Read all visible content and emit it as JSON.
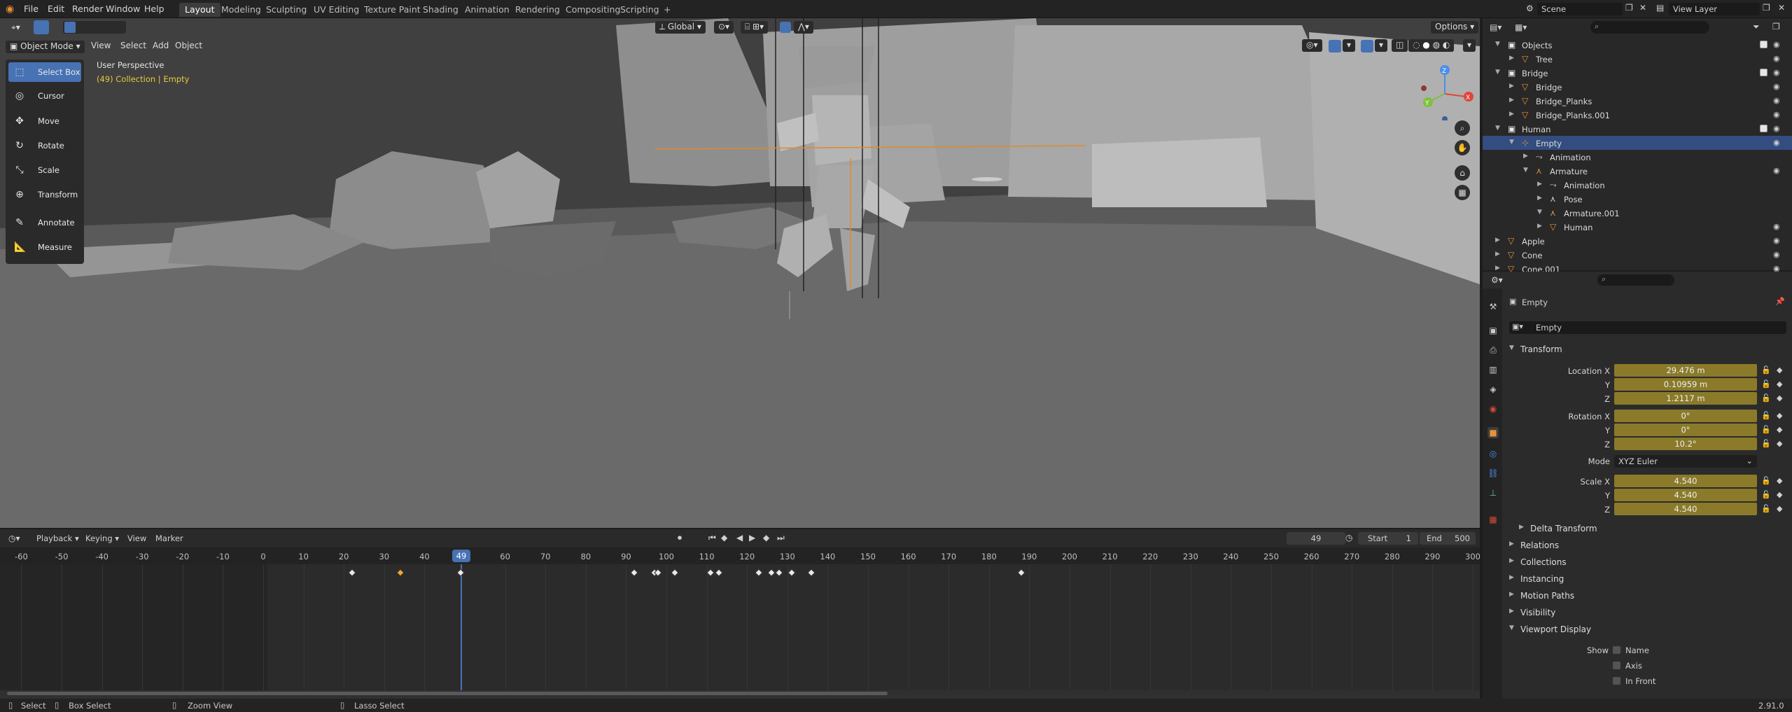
{
  "app": {
    "menu": [
      "File",
      "Edit",
      "Render",
      "Window",
      "Help"
    ],
    "workspaces": [
      "Layout",
      "Modeling",
      "Sculpting",
      "UV Editing",
      "Texture Paint",
      "Shading",
      "Animation",
      "Rendering",
      "Compositing",
      "Scripting"
    ],
    "add_tab": "+",
    "scene_name": "Scene",
    "view_layer": "View Layer",
    "version": "2.91.0"
  },
  "viewport": {
    "mode": "Object Mode",
    "menus": [
      "View",
      "Select",
      "Add",
      "Object"
    ],
    "orientation": "Global",
    "options": "Options",
    "overlay_title": "User Perspective",
    "overlay_sub": "(49) Collection | Empty",
    "gizmo": {
      "z": "Z",
      "y": "Y",
      "x": "X"
    }
  },
  "toolbar": {
    "tools": [
      {
        "label": "Select Box",
        "icon": "select-box-icon",
        "active": true
      },
      {
        "label": "Cursor",
        "icon": "cursor-icon",
        "active": false
      },
      {
        "label": "Move",
        "icon": "move-icon",
        "active": false
      },
      {
        "label": "Rotate",
        "icon": "rotate-icon",
        "active": false
      },
      {
        "label": "Scale",
        "icon": "scale-icon",
        "active": false
      },
      {
        "label": "Transform",
        "icon": "transform-icon",
        "active": false
      },
      {
        "label": "Annotate",
        "icon": "annotate-icon",
        "active": false
      },
      {
        "label": "Measure",
        "icon": "measure-icon",
        "active": false
      }
    ]
  },
  "timeline": {
    "menus": [
      "Playback",
      "Keying",
      "View",
      "Marker"
    ],
    "current_frame": "49",
    "start_label": "Start",
    "start": "1",
    "end_label": "End",
    "end": "500",
    "ticks": [
      "-60",
      "-50",
      "-40",
      "-30",
      "-20",
      "-10",
      "0",
      "10",
      "20",
      "30",
      "40",
      "49",
      "60",
      "70",
      "80",
      "90",
      "100",
      "110",
      "120",
      "130",
      "140",
      "150",
      "160",
      "170",
      "180",
      "190",
      "200",
      "210",
      "220",
      "230",
      "240",
      "250",
      "260",
      "270",
      "280",
      "290",
      "300"
    ],
    "keyframes": [
      22,
      34,
      49,
      92,
      97,
      98,
      102,
      111,
      113,
      123,
      126,
      128,
      131,
      136,
      188
    ],
    "selected_keyframe": 34
  },
  "statusbar": {
    "select": "Select",
    "box_select": "Box Select",
    "zoom": "Zoom View",
    "lasso": "Lasso Select"
  },
  "outliner": {
    "rows": [
      {
        "label": "Objects",
        "indent": 1,
        "type": "collection",
        "check": true,
        "eye": true
      },
      {
        "label": "Tree",
        "indent": 2,
        "type": "mesh",
        "check": false,
        "eye": true
      },
      {
        "label": "Bridge",
        "indent": 1,
        "type": "collection",
        "check": true,
        "eye": true
      },
      {
        "label": "Bridge",
        "indent": 2,
        "type": "mesh",
        "check": false,
        "eye": true
      },
      {
        "label": "Bridge_Planks",
        "indent": 2,
        "type": "mesh",
        "check": false,
        "eye": true
      },
      {
        "label": "Bridge_Planks.001",
        "indent": 2,
        "type": "mesh",
        "check": false,
        "eye": true
      },
      {
        "label": "Human",
        "indent": 1,
        "type": "collection",
        "check": true,
        "eye": true
      },
      {
        "label": "Empty",
        "indent": 2,
        "type": "empty",
        "check": false,
        "eye": true,
        "selected": true
      },
      {
        "label": "Animation",
        "indent": 3,
        "type": "action",
        "check": false,
        "eye": false
      },
      {
        "label": "Armature",
        "indent": 3,
        "type": "armature",
        "check": false,
        "eye": true
      },
      {
        "label": "Animation",
        "indent": 4,
        "type": "action",
        "check": false,
        "eye": false
      },
      {
        "label": "Pose",
        "indent": 4,
        "type": "pose",
        "check": false,
        "eye": false
      },
      {
        "label": "Armature.001",
        "indent": 4,
        "type": "armature",
        "check": false,
        "eye": false
      },
      {
        "label": "Human",
        "indent": 4,
        "type": "mesh",
        "check": false,
        "eye": true
      },
      {
        "label": "Apple",
        "indent": 1,
        "type": "mesh",
        "check": false,
        "eye": true
      },
      {
        "label": "Cone",
        "indent": 1,
        "type": "mesh",
        "check": false,
        "eye": true
      },
      {
        "label": "Cone.001",
        "indent": 1,
        "type": "mesh",
        "check": false,
        "eye": true
      }
    ]
  },
  "properties": {
    "object_name": "Empty",
    "data_name": "Empty",
    "transform_title": "Transform",
    "location_label": "Location X",
    "location": [
      "29.476 m",
      "0.10959 m",
      "1.2117 m"
    ],
    "rotation_label": "Rotation X",
    "rotation": [
      "0°",
      "0°",
      "10.2°"
    ],
    "mode_label": "Mode",
    "mode_value": "XYZ Euler",
    "scale_label": "Scale X",
    "scale": [
      "4.540",
      "4.540",
      "4.540"
    ],
    "y_label": "Y",
    "z_label": "Z",
    "collapsed_panels": [
      "Delta Transform",
      "Relations",
      "Collections",
      "Instancing",
      "Motion Paths",
      "Visibility"
    ],
    "viewport_display": "Viewport Display",
    "show_label": "Show",
    "show_options": [
      "Name",
      "Axis",
      "In Front"
    ]
  },
  "colors": {
    "accent": "#4772b3",
    "field_yellow": "#8a7a2a",
    "keyframe": "#e9e9e9",
    "keyframe_selected": "#f0a63b",
    "mesh_icon": "#e8913a",
    "modifier_icon": "#5fc4a0"
  }
}
